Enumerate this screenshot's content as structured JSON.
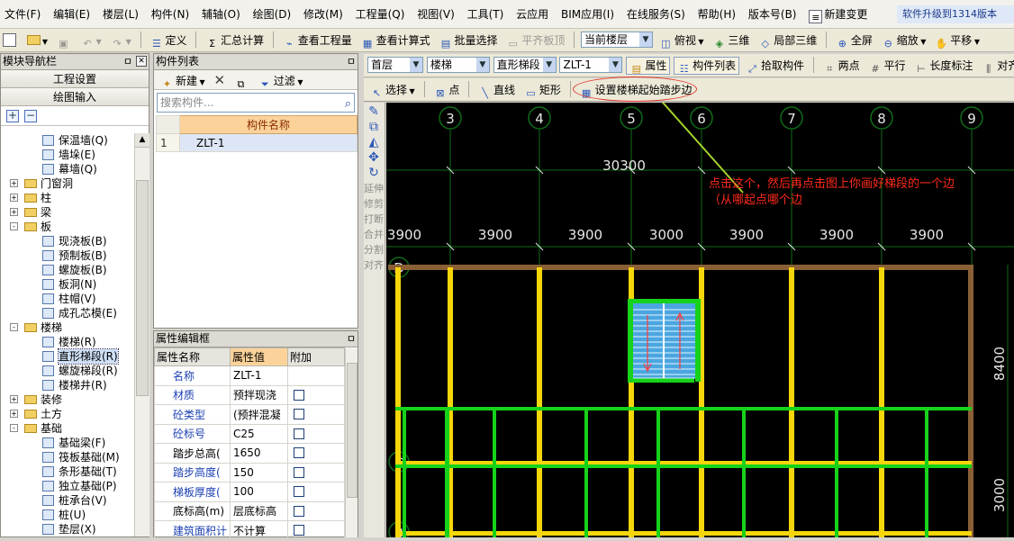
{
  "menubar": {
    "items": [
      "文件(F)",
      "编辑(E)",
      "楼层(L)",
      "构件(N)",
      "辅轴(O)",
      "绘图(D)",
      "修改(M)",
      "工程量(Q)",
      "视图(V)",
      "工具(T)",
      "云应用",
      "BIM应用(I)",
      "在线服务(S)",
      "帮助(H)",
      "版本号(B)"
    ],
    "new_change": "新建变更",
    "upgrade_notice": "软件升级到1314版本"
  },
  "toolbar1": {
    "define": "定义",
    "sum_calc": "汇总计算",
    "view_quantity": "查看工程量",
    "view_formula": "查看计算式",
    "batch_select": "批量选择",
    "flush_board": "平齐板顶",
    "floor_scope": "当前楼层",
    "view_mode": "俯视",
    "three_d": "三维",
    "local_3d": "局部三维",
    "fullscreen": "全屏",
    "zoom": "缩放",
    "pan": "平移"
  },
  "nav_panel": {
    "title": "模块导航栏",
    "project_settings": "工程设置",
    "drawing_input": "绘图输入",
    "tree": [
      {
        "label": "保温墙(Q)",
        "kind": "leaf",
        "level": 2
      },
      {
        "label": "墙垛(E)",
        "kind": "leaf",
        "level": 2
      },
      {
        "label": "幕墙(Q)",
        "kind": "leaf",
        "level": 2
      },
      {
        "label": "门窗洞",
        "kind": "folder",
        "level": 1,
        "state": "+"
      },
      {
        "label": "柱",
        "kind": "folder",
        "level": 1,
        "state": "+"
      },
      {
        "label": "梁",
        "kind": "folder",
        "level": 1,
        "state": "+"
      },
      {
        "label": "板",
        "kind": "folder",
        "level": 1,
        "state": "-"
      },
      {
        "label": "现浇板(B)",
        "kind": "leaf",
        "level": 2
      },
      {
        "label": "预制板(B)",
        "kind": "leaf",
        "level": 2
      },
      {
        "label": "螺旋板(B)",
        "kind": "leaf",
        "level": 2
      },
      {
        "label": "板洞(N)",
        "kind": "leaf",
        "level": 2
      },
      {
        "label": "柱帽(V)",
        "kind": "leaf",
        "level": 2
      },
      {
        "label": "成孔芯模(E)",
        "kind": "leaf",
        "level": 2
      },
      {
        "label": "楼梯",
        "kind": "folder",
        "level": 1,
        "state": "-"
      },
      {
        "label": "楼梯(R)",
        "kind": "leaf",
        "level": 2
      },
      {
        "label": "直形梯段(R)",
        "kind": "leaf",
        "level": 2,
        "selected": true
      },
      {
        "label": "螺旋梯段(R)",
        "kind": "leaf",
        "level": 2
      },
      {
        "label": "楼梯井(R)",
        "kind": "leaf",
        "level": 2
      },
      {
        "label": "装修",
        "kind": "folder",
        "level": 1,
        "state": "+"
      },
      {
        "label": "土方",
        "kind": "folder",
        "level": 1,
        "state": "+"
      },
      {
        "label": "基础",
        "kind": "folder",
        "level": 1,
        "state": "-"
      },
      {
        "label": "基础梁(F)",
        "kind": "leaf",
        "level": 2
      },
      {
        "label": "筏板基础(M)",
        "kind": "leaf",
        "level": 2
      },
      {
        "label": "条形基础(T)",
        "kind": "leaf",
        "level": 2
      },
      {
        "label": "独立基础(P)",
        "kind": "leaf",
        "level": 2
      },
      {
        "label": "桩承台(V)",
        "kind": "leaf",
        "level": 2
      },
      {
        "label": "桩(U)",
        "kind": "leaf",
        "level": 2
      },
      {
        "label": "垫层(X)",
        "kind": "leaf",
        "level": 2
      }
    ]
  },
  "component_list": {
    "title": "构件列表",
    "new": "新建",
    "filter": "过滤",
    "search_placeholder": "搜索构件...",
    "column": "构件名称",
    "rows": [
      {
        "index": "1",
        "name": "ZLT-1"
      }
    ]
  },
  "property_panel": {
    "title": "属性编辑框",
    "headers": {
      "name": "属性名称",
      "value": "属性值",
      "extra": "附加"
    },
    "rows": [
      {
        "name": "名称",
        "value": "ZLT-1",
        "check": false,
        "blue": true
      },
      {
        "name": "材质",
        "value": "预拌现浇",
        "check": true,
        "blue": true
      },
      {
        "name": "砼类型",
        "value": "(预拌混凝",
        "check": true,
        "blue": true
      },
      {
        "name": "砼标号",
        "value": "C25",
        "check": true,
        "blue": true
      },
      {
        "name": "踏步总高(",
        "value": "1650",
        "check": true,
        "blue": false
      },
      {
        "name": "踏步高度(",
        "value": "150",
        "check": true,
        "blue": true
      },
      {
        "name": "梯板厚度(",
        "value": "100",
        "check": true,
        "blue": true
      },
      {
        "name": "底标高(m)",
        "value": "层底标高",
        "check": true,
        "blue": false
      },
      {
        "name": "建筑面积计",
        "value": "不计算",
        "check": true,
        "blue": true
      }
    ]
  },
  "toolbar2": {
    "floor": "首层",
    "category": "楼梯",
    "type": "直形梯段",
    "component": "ZLT-1",
    "attributes": "属性",
    "component_list": "构件列表",
    "pick_component": "拾取构件",
    "two_points": "两点",
    "parallel": "平行",
    "length_dim": "长度标注",
    "align": "对齐"
  },
  "toolbar3": {
    "select": "选择",
    "point": "点",
    "line": "直线",
    "rect": "矩形",
    "set_start_edge": "设置楼梯起始踏步边"
  },
  "left_tools": [
    "延伸",
    "修剪",
    "打断",
    "合并",
    "分割",
    "对齐"
  ],
  "drawing": {
    "axis_labels": [
      "3",
      "4",
      "5",
      "6",
      "7",
      "8",
      "9"
    ],
    "row_labels": [
      "D",
      "C",
      "B"
    ],
    "total_dim": "30300",
    "span_dims": [
      "3900",
      "3900",
      "3900",
      "3000",
      "3900",
      "3900",
      "3900"
    ],
    "right_dims": [
      "8400",
      "3000"
    ],
    "annotation": "点击这个，然后再点击图上你画好梯段的一个边（从哪起点哪个边",
    "colors": {
      "beam": "#f5d60a",
      "wall": "#8a5f36",
      "green": "#16d21a",
      "grid": "#0f6b19",
      "stair": "#4aa6e0",
      "label": "#e6e6e6",
      "arrow": "#a6d22a",
      "callout": "#ff2a1a"
    }
  }
}
